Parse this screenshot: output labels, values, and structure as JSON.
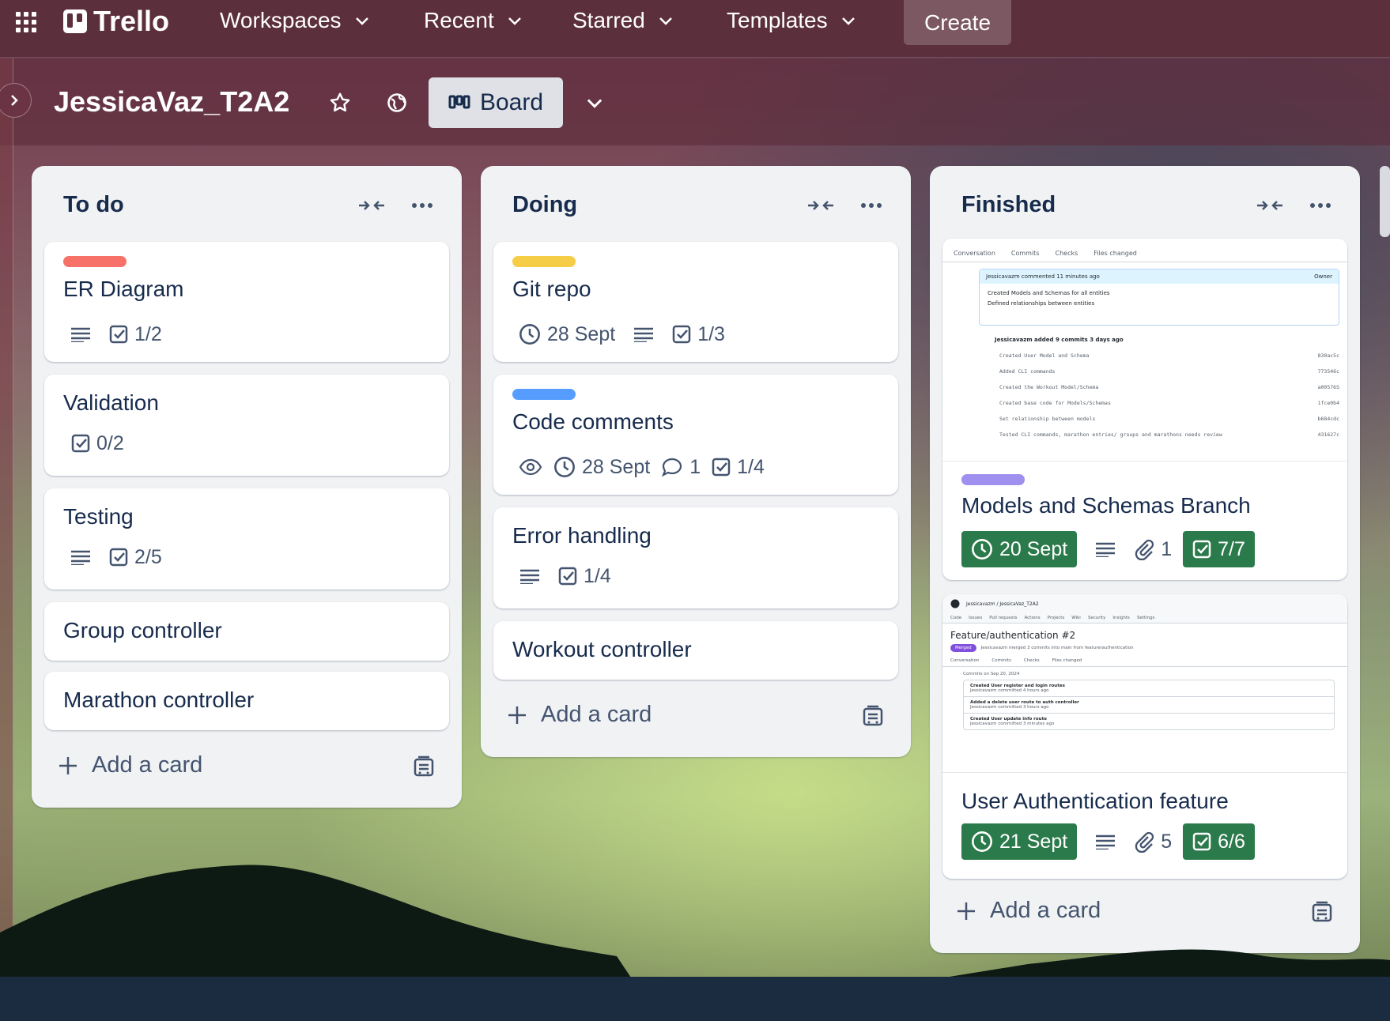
{
  "topbar": {
    "brand": "Trello",
    "nav": [
      {
        "label": "Workspaces"
      },
      {
        "label": "Recent"
      },
      {
        "label": "Starred"
      },
      {
        "label": "Templates"
      }
    ],
    "create_label": "Create"
  },
  "board": {
    "title": "JessicaVaz_T2A2",
    "view_label": "Board"
  },
  "colors": {
    "red_label": "#f87168",
    "yellow_label": "#f5cd47",
    "blue_label": "#579dff",
    "purple_label": "#9f8fef",
    "complete_green": "#2b7a4b"
  },
  "lists": [
    {
      "title": "To do",
      "cards": [
        {
          "title": "ER Diagram",
          "label_color": "red",
          "has_description": true,
          "checklist": "1/2"
        },
        {
          "title": "Validation",
          "checklist": "0/2"
        },
        {
          "title": "Testing",
          "has_description": true,
          "checklist": "2/5"
        },
        {
          "title": "Group controller"
        },
        {
          "title": "Marathon controller"
        }
      ],
      "add_label": "Add a card"
    },
    {
      "title": "Doing",
      "cards": [
        {
          "title": "Git repo",
          "label_color": "yellow",
          "due": "28 Sept",
          "has_description": true,
          "checklist": "1/3"
        },
        {
          "title": "Code comments",
          "label_color": "blue",
          "watching": true,
          "due": "28 Sept",
          "comments": "1",
          "checklist": "1/4"
        },
        {
          "title": "Error handling",
          "has_description": true,
          "checklist": "1/4"
        },
        {
          "title": "Workout controller"
        }
      ],
      "add_label": "Add a card"
    },
    {
      "title": "Finished",
      "cards": [
        {
          "title": "Models and Schemas Branch",
          "label_color": "purple",
          "due": "20 Sept",
          "has_description": true,
          "attachments": "1",
          "checklist": "7/7",
          "cover": {
            "tabs": [
              "Conversation",
              "Commits",
              "Checks",
              "Files changed"
            ],
            "commenter": "Jessicavazm commented 11 minutes ago",
            "owner_tag": "Owner",
            "bullets": [
              "Created Models and Schemas for all entities",
              "Defined relationships between entities"
            ],
            "commits_header": "Jessicavazm added 9 commits 3 days ago",
            "commits": [
              "Created User Model and Schema",
              "Added CLI commands",
              "Created the Workout Model/Schema",
              "Created base code for Models/Schemas",
              "Set relationship between models",
              "Tested CLI commands, marathon entries/ groups and marathons needs review"
            ],
            "shas": [
              "830ac5c",
              "773546c",
              "a00576S",
              "1fce0b4",
              "b684cdc",
              "431627c"
            ]
          }
        },
        {
          "title": "User Authentication feature",
          "due": "21 Sept",
          "has_description": true,
          "attachments": "5",
          "checklist": "6/6",
          "cover": {
            "repo": "Jessicavazm / JessicaVaz_T2A2",
            "tabs": [
              "Code",
              "Issues",
              "Pull requests",
              "Actions",
              "Projects",
              "Wiki",
              "Security",
              "Insights",
              "Settings"
            ],
            "pr_title": "Feature/authentication #2",
            "merged": "Merged",
            "merge_text": "Jessicavazm merged 3 commits into main from feature/authentication",
            "subtabs": [
              "Conversation",
              "Commits",
              "Checks",
              "Files changed"
            ],
            "commits_date": "Commits on Sep 20, 2024",
            "commits": [
              "Created User register and login routes",
              "Added a delete user route to auth controller",
              "Created User update info route"
            ],
            "commit_meta": [
              "Jessicavazm committed 4 hours ago",
              "Jessicavazm committed 3 hours ago",
              "Jessicavazm committed 3 minutes ago"
            ]
          }
        }
      ],
      "add_label": "Add a card"
    }
  ]
}
